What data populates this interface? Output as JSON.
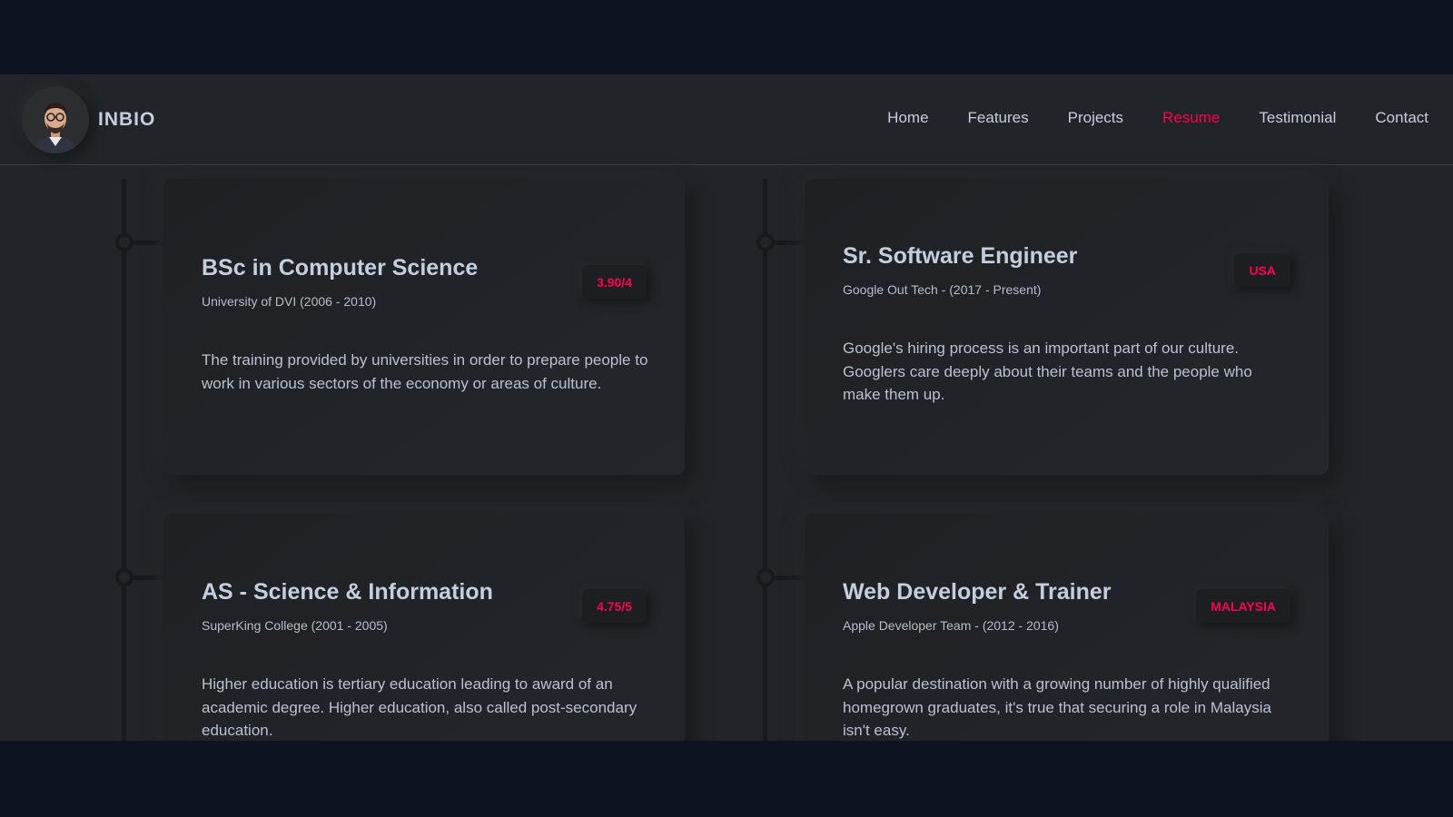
{
  "header": {
    "brand": "INBIO",
    "nav": [
      {
        "label": "Home"
      },
      {
        "label": "Features"
      },
      {
        "label": "Projects"
      },
      {
        "label": "Resume"
      },
      {
        "label": "Testimonial"
      },
      {
        "label": "Contact"
      }
    ],
    "active_nav": "Resume"
  },
  "education": [
    {
      "title": "BSc in Computer Science",
      "subtitle": "University of DVI (2006 - 2010)",
      "badge": "3.90/4",
      "description": "The training provided by universities in order to prepare people to work in various sectors of the economy or areas of culture."
    },
    {
      "title": "AS - Science & Information",
      "subtitle": "SuperKing College (2001 - 2005)",
      "badge": "4.75/5",
      "description": "Higher education is tertiary education leading to award of an academic degree. Higher education, also called post-secondary education."
    }
  ],
  "experience": [
    {
      "title": "Sr. Software Engineer",
      "subtitle": "Google Out Tech - (2017 - Present)",
      "badge": "USA",
      "description": "Google's hiring process is an important part of our culture. Googlers care deeply about their teams and the people who make them up."
    },
    {
      "title": "Web Developer & Trainer",
      "subtitle": "Apple Developer Team - (2012 - 2016)",
      "badge": "MALAYSIA",
      "description": "A popular destination with a growing number of highly qualified homegrown graduates, it's true that securing a role in Malaysia isn't easy."
    }
  ],
  "colors": {
    "accent": "#ff014f",
    "background": "#212428",
    "text": "#c4cfde",
    "outer": "#0d1320"
  }
}
